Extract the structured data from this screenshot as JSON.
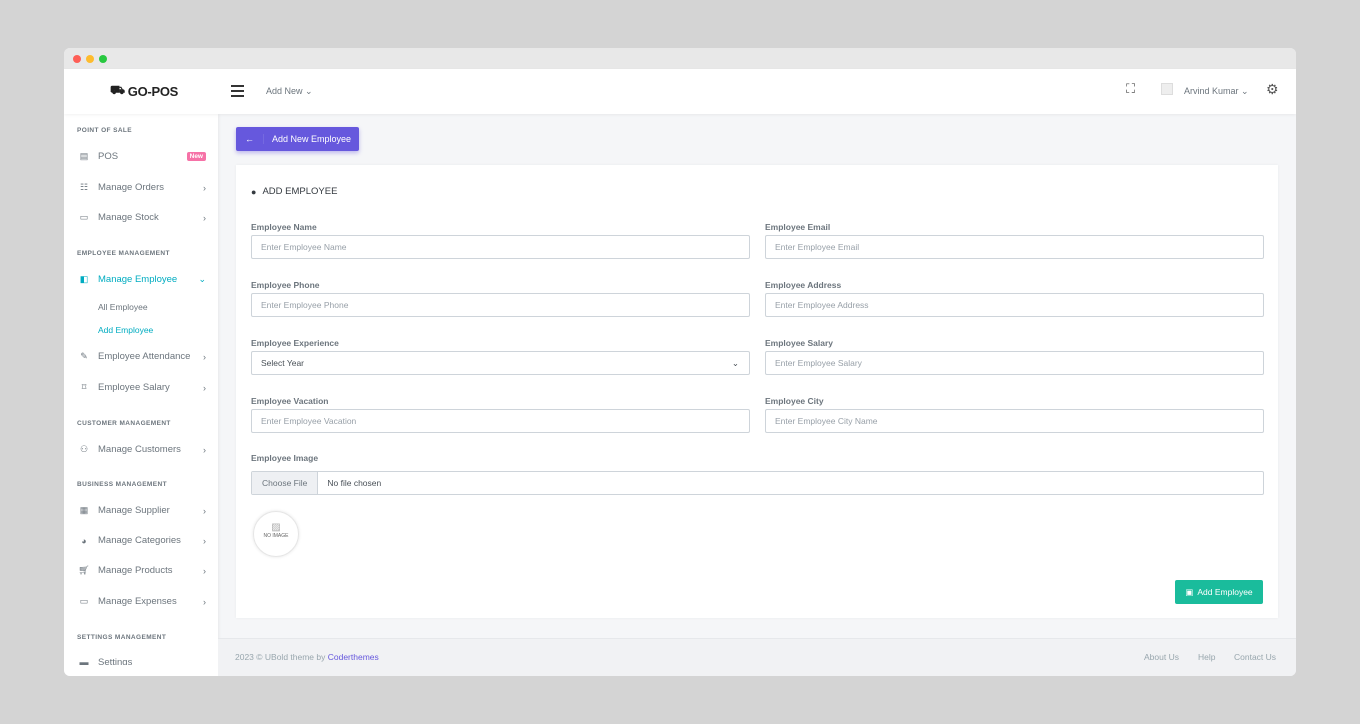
{
  "colors": {
    "primary": "#6658dd",
    "success": "#1abc9c",
    "active": "#00acc1",
    "badge": "#f672a7"
  },
  "brand": "GO-POS",
  "topbar": {
    "add_new": "Add New",
    "user": "Arvind Kumar"
  },
  "sidebar": {
    "sections": [
      "POINT OF SALE",
      "EMPLOYEE MANAGEMENT",
      "CUSTOMER MANAGEMENT",
      "BUSINESS MANAGEMENT",
      "SETTINGS MANAGEMENT"
    ],
    "items": [
      {
        "label": "POS",
        "badge": "New"
      },
      {
        "label": "Manage Orders"
      },
      {
        "label": "Manage Stock"
      },
      {
        "label": "Manage Employee"
      },
      {
        "label": "Employee Attendance"
      },
      {
        "label": "Employee Salary"
      },
      {
        "label": "Manage Customers"
      },
      {
        "label": "Manage Supplier"
      },
      {
        "label": "Manage Categories"
      },
      {
        "label": "Manage Products"
      },
      {
        "label": "Manage Expenses"
      },
      {
        "label": "Settings"
      }
    ],
    "subitems": [
      "All Employee",
      "Add Employee"
    ]
  },
  "page": {
    "back_button": "Add New Employee",
    "card_title": "ADD EMPLOYEE"
  },
  "form": {
    "fields": [
      {
        "label": "Employee Name",
        "placeholder": "Enter Employee Name"
      },
      {
        "label": "Employee Email",
        "placeholder": "Enter Employee Email"
      },
      {
        "label": "Employee Phone",
        "placeholder": "Enter Employee Phone"
      },
      {
        "label": "Employee Address",
        "placeholder": "Enter Employee Address"
      },
      {
        "label": "Employee Experience",
        "placeholder": "Select Year"
      },
      {
        "label": "Employee Salary",
        "placeholder": "Enter Employee Salary"
      },
      {
        "label": "Employee Vacation",
        "placeholder": "Enter Employee Vacation"
      },
      {
        "label": "Employee City",
        "placeholder": "Enter Employee City Name"
      }
    ],
    "image_label": "Employee Image",
    "choose_file": "Choose File",
    "no_file": "No file chosen",
    "no_image": "NO IMAGE",
    "submit": "Add Employee"
  },
  "footer": {
    "copyright": "2023 © UBold theme by ",
    "author": "Coderthemes",
    "links": [
      "About Us",
      "Help",
      "Contact Us"
    ]
  }
}
